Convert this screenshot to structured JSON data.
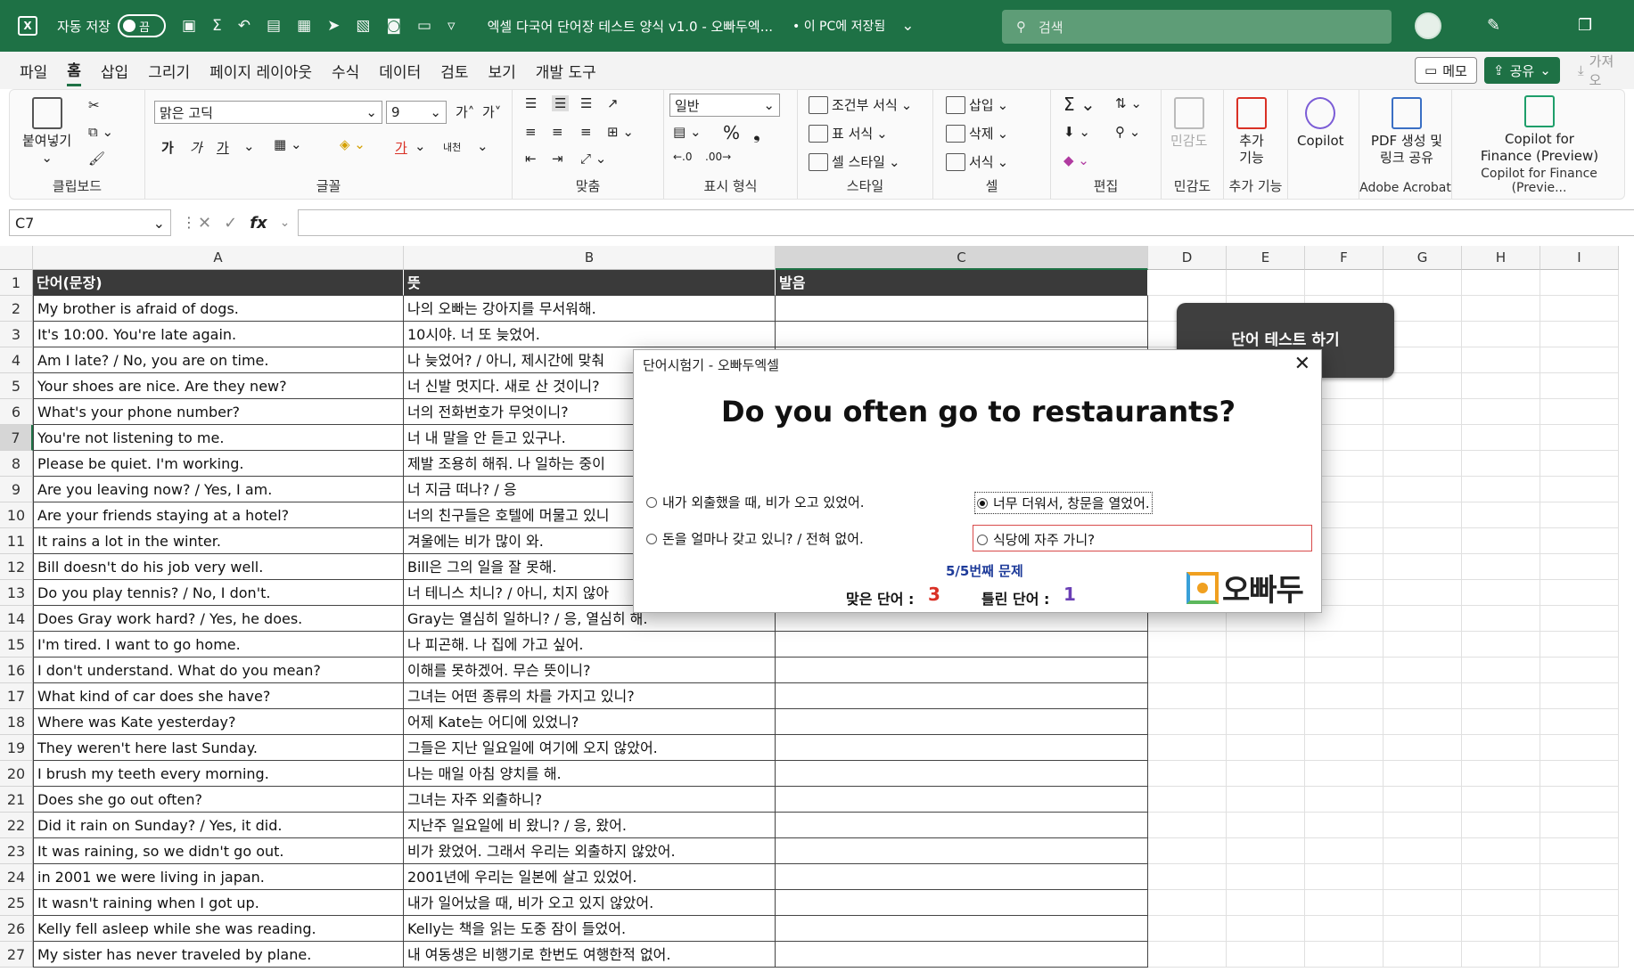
{
  "titlebar": {
    "autosave_label": "자동 저장",
    "autosave_state": "끔",
    "doc_title": "엑셀 다국어 단어장 테스트 양식 v1.0 - 오빠두엑...",
    "saved_state": "• 이 PC에 저장됨",
    "search_placeholder": "검색"
  },
  "menu": {
    "items": [
      "파일",
      "홈",
      "삽입",
      "그리기",
      "페이지 레이아웃",
      "수식",
      "데이터",
      "검토",
      "보기",
      "개발 도구"
    ],
    "active": "홈",
    "memo": "메모",
    "share": "공유",
    "import": "가져오"
  },
  "ribbon": {
    "clipboard": {
      "label": "클립보드",
      "paste": "붙여넣기"
    },
    "font": {
      "label": "글꼴",
      "name": "맑은 고딕",
      "size": "9",
      "bold": "가",
      "italic": "가",
      "underline": "가",
      "fontcolor": "가",
      "phonetic": "내천"
    },
    "align": {
      "label": "맞춤"
    },
    "number": {
      "label": "표시 형식",
      "format": "일반"
    },
    "style": {
      "label": "스타일",
      "conditional": "조건부 서식",
      "table": "표 서식",
      "cell": "셀 스타일"
    },
    "cells": {
      "label": "셀",
      "insert": "삽입",
      "delete": "삭제",
      "format": "서식"
    },
    "edit": {
      "label": "편집"
    },
    "sensitivity": {
      "label": "민감도",
      "btn": "민감도"
    },
    "addins": {
      "label": "추가 기능",
      "btn1": "추가",
      "btn2": "기능"
    },
    "copilot": {
      "btn": "Copilot"
    },
    "acrobat": {
      "label": "Adobe Acrobat",
      "btn1": "PDF 생성 및",
      "btn2": "링크 공유"
    },
    "finance": {
      "label": "Copilot for Finance (Previe...",
      "btn1": "Copilot for",
      "btn2": "Finance (Preview)"
    }
  },
  "formula": {
    "namebox": "C7",
    "fx": "fx",
    "content": ""
  },
  "columns": [
    "A",
    "B",
    "C",
    "D",
    "E",
    "F",
    "G",
    "H",
    "I"
  ],
  "headers": {
    "a": "단어(문장)",
    "b": "뜻",
    "c": "발음"
  },
  "rows": [
    [
      "My brother is afraid of dogs.",
      "나의 오빠는 강아지를 무서워해."
    ],
    [
      "It's 10:00. You're late again.",
      "10시야. 너 또 늦었어."
    ],
    [
      "Am I late? / No, you are on time.",
      "나 늦었어? / 아니, 제시간에 맞춰"
    ],
    [
      "Your shoes are nice. Are they new?",
      "너 신발 멋지다. 새로 산 것이니?"
    ],
    [
      "What's your phone number?",
      "너의 전화번호가 무엇이니?"
    ],
    [
      "You're not listening to me.",
      "너 내 말을 안 듣고 있구나."
    ],
    [
      "Please be quiet. I'm working.",
      "제발 조용히 해줘. 나 일하는 중이"
    ],
    [
      "Are you leaving now? / Yes, I am.",
      "너 지금 떠나? / 응"
    ],
    [
      "Are your friends staying at a hotel?",
      "너의 친구들은 호텔에 머물고 있니"
    ],
    [
      "It rains a lot in the winter.",
      "겨울에는 비가 많이 와."
    ],
    [
      "Bill doesn't do his job very well.",
      "Bill은 그의 일을 잘 못해."
    ],
    [
      "Do you play tennis? / No, I don't.",
      "너 테니스 치니? / 아니, 치지 않아"
    ],
    [
      "Does Gray work hard? / Yes, he does.",
      "Gray는 열심히 일하니? / 응, 열심히 해."
    ],
    [
      "I'm tired. I want to go home.",
      "나 피곤해. 나 집에 가고 싶어."
    ],
    [
      "I don't understand. What do you mean?",
      "이해를 못하겠어. 무슨 뜻이니?"
    ],
    [
      "What kind of car does she have?",
      "그녀는 어떤 종류의 차를 가지고 있니?"
    ],
    [
      "Where was Kate yesterday?",
      "어제 Kate는 어디에 있었니?"
    ],
    [
      "They weren't here last Sunday.",
      "그들은 지난 일요일에 여기에 오지 않았어."
    ],
    [
      "I brush my teeth every morning.",
      "나는 매일 아침 양치를 해."
    ],
    [
      "Does she go out often?",
      "그녀는 자주 외출하니?"
    ],
    [
      "Did it rain on Sunday? / Yes, it did.",
      "지난주 일요일에 비 왔니? / 응, 왔어."
    ],
    [
      "It was raining, so we didn't go out.",
      "비가 왔었어. 그래서 우리는 외출하지 않았어."
    ],
    [
      "in 2001 we were living in japan.",
      "2001년에 우리는 일본에 살고 있었어."
    ],
    [
      "It wasn't raining when I got up.",
      "내가 일어났을 때, 비가 오고 있지 않았어."
    ],
    [
      "Kelly fell asleep while she was reading.",
      "Kelly는 책을 읽는 도중 잠이 들었어."
    ],
    [
      "My sister has never traveled by plane.",
      "내 여동생은 비행기로 한번도 여행한적 없어."
    ]
  ],
  "test_button": "단어 테스트 하기",
  "dialog": {
    "title": "단어시험기 - 오빠두엑셀",
    "question": "Do you often go to restaurants?",
    "options": [
      "내가 외출했을 때, 비가 오고 있었어.",
      "너무 더워서, 창문을 열었어.",
      "돈을 얼마나 갖고 있니? / 전혀 없어.",
      "식당에 자주 가니?"
    ],
    "selected_index": 1,
    "progress": "5/5번째 문제",
    "correct_label": "맞은 단어 :",
    "correct_value": "3",
    "wrong_label": "틀린 단어 :",
    "wrong_value": "1",
    "logo_text": "오빠두"
  },
  "colors": {
    "excel_green": "#1e7145",
    "correct": "#d93025",
    "wrong": "#6a3fb5",
    "progress": "#1f3c9a",
    "option_box": "#d84a4a"
  }
}
